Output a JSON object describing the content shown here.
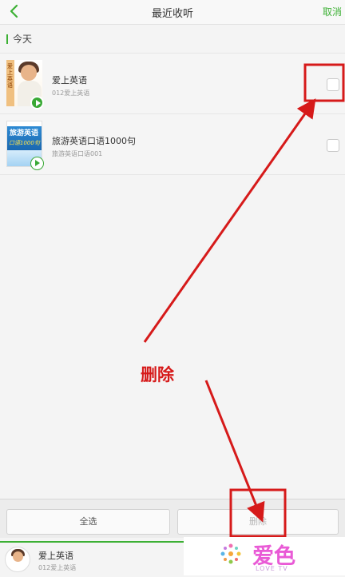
{
  "header": {
    "title": "最近收听",
    "cancel_label": "取消"
  },
  "section": {
    "label": "今天"
  },
  "items": [
    {
      "title": "爱上英语",
      "subtitle": "012爱上英语",
      "cover_text": "爱上英语"
    },
    {
      "title": "旅游英语口语1000句",
      "subtitle": "旅游英语口语001",
      "cover_text": "旅游英语",
      "cover_text2": "口语1000句"
    }
  ],
  "footer": {
    "select_all_label": "全选",
    "delete_label": "删除"
  },
  "player": {
    "title": "爱上英语",
    "subtitle": "012爱上英语"
  },
  "annotation": {
    "label": "删除"
  },
  "watermark": {
    "brand": "爱色",
    "tagline": "LOVE TV"
  },
  "colors": {
    "accent": "#3cb034",
    "annotation": "#d61a1a"
  }
}
